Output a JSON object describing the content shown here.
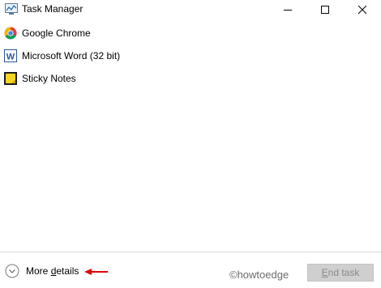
{
  "window": {
    "title": "Task Manager",
    "controls": {
      "minimize": "minimize-icon",
      "maximize": "maximize-icon",
      "close": "close-icon"
    }
  },
  "processes": [
    {
      "label": "Google Chrome",
      "icon": "chrome-icon"
    },
    {
      "label": "Microsoft Word (32 bit)",
      "icon": "word-icon"
    },
    {
      "label": "Sticky Notes",
      "icon": "sticky-notes-icon"
    }
  ],
  "footer": {
    "more_details_prefix": "More ",
    "more_details_underlined": "d",
    "more_details_suffix": "etails",
    "end_task_prefix": "",
    "end_task_underlined": "E",
    "end_task_suffix": "nd task",
    "watermark": "©howtoedge",
    "end_task_enabled": false
  },
  "colors": {
    "arrow": "#e00000",
    "end_task_bg": "#cfcfcf",
    "end_task_text": "#8a8a8a"
  }
}
